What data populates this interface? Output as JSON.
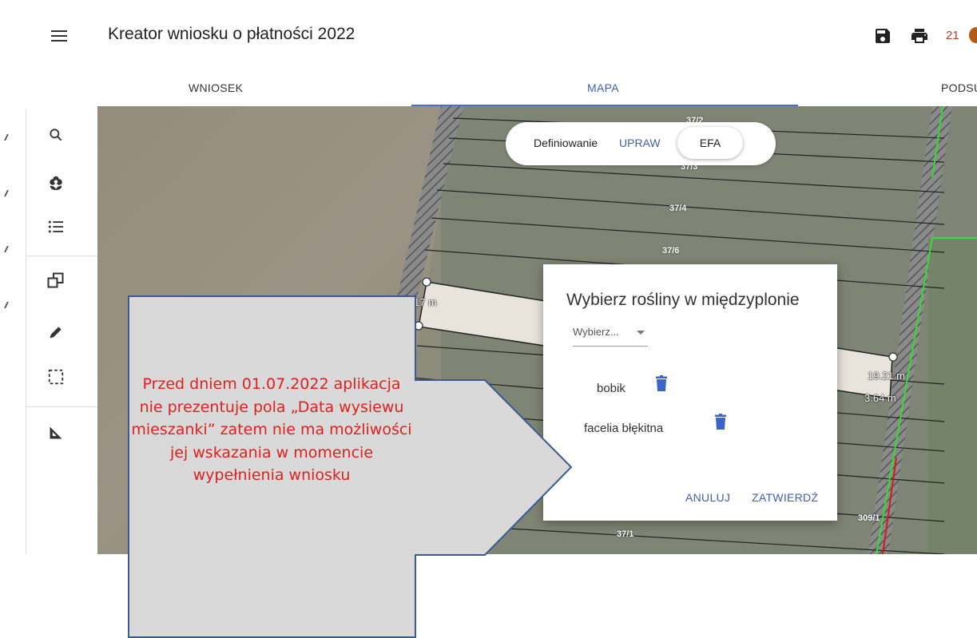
{
  "header": {
    "title": "Kreator wniosku o płatności 2022",
    "notification_count": "21"
  },
  "tabs": [
    {
      "label": "WNIOSEK"
    },
    {
      "label": "MAPA"
    },
    {
      "label": "PODSU"
    }
  ],
  "toolbar": {
    "tools": [
      "search-icon",
      "flower-icon",
      "list-icon",
      "copy-icon",
      "pencil-icon",
      "selection-icon",
      "ruler-icon"
    ]
  },
  "map": {
    "parcels": [
      "37/2",
      "37/3",
      "37/4",
      "37/6",
      "37/1",
      "309/1"
    ],
    "measurements": [
      "17 m",
      "19.21 m",
      "3.64 m"
    ]
  },
  "mode_toggle": {
    "label": "Definiowanie",
    "upraw": "UPRAW",
    "efa": "EFA"
  },
  "dialog": {
    "title": "Wybierz rośliny w międzyplonie",
    "select_placeholder": "Wybierz...",
    "plants": [
      {
        "name": "bobik"
      },
      {
        "name": "facelia błękitna"
      }
    ],
    "cancel": "ANULUJ",
    "confirm": "ZATWIERDŹ"
  },
  "callout": {
    "text": "Przed dniem 01.07.2022 aplikacja nie prezentuje pola „Data wysiewu mieszanki” zatem nie ma możliwości jej wskazania w momencie wypełnienia wniosku",
    "colors": {
      "fill": "#d9d9d9",
      "border": "#3d5a8c",
      "text": "#e0201e"
    }
  },
  "colors": {
    "accent": "#3f5fb0",
    "parcel_outline": "#33dd33"
  }
}
